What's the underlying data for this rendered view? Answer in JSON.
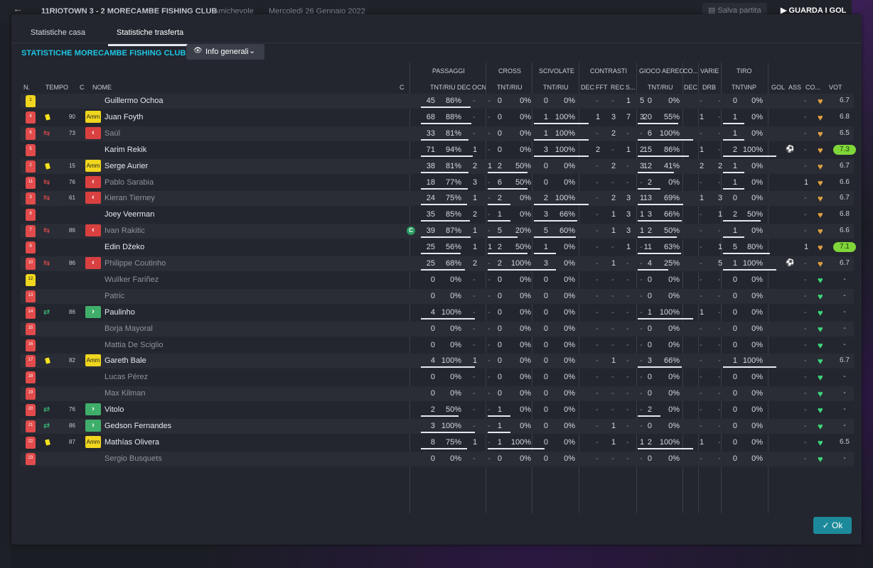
{
  "topbar": {
    "back_icon": "back-arrow-icon",
    "match": "11RIOTOWN   3 - 2   MORECAMBE FISHING CLUB",
    "type": "Amichevole",
    "date": "Mercoledì 26 Gennaio 2022",
    "save_label": "Salva partita",
    "goals_label": "GUARDA I GOL"
  },
  "tabs": [
    "Statistiche casa",
    "Statistiche trasferta"
  ],
  "active_tab": 1,
  "title": "STATISTICHE MORECAMBE FISHING CLUB",
  "dropdown": {
    "label": "Info generali",
    "icon": "eye-icon"
  },
  "groups": {
    "passaggi": "PASSAGGI",
    "cross": "CROSS",
    "scivolate": "SCIVOLATE",
    "contrasti": "CONTRASTI",
    "gioco_aereo": "GIOCO AEREO",
    "co": "CO...",
    "varie": "VARIE",
    "tiro": "TIRO"
  },
  "columns": {
    "n": "N.",
    "tempo": "TEMPO",
    "c": "C",
    "nome": "NOME",
    "c2": "C",
    "pass_tnt": "TNT/RIU",
    "pass_dec": "DEC",
    "pass_ocn": "OCN",
    "cross_tnt": "TNT/RIU",
    "sciv_tnt": "TNT/RIU",
    "con_dec": "DEC",
    "con_fft": "FFT",
    "con_rec": "REC",
    "con_s": "S...",
    "aereo_tnt": "TNT/RIU",
    "co_dec": "DEC",
    "drb": "DRB",
    "tiro": "TNT\\INP",
    "gol": "GOL",
    "ass": "ASS",
    "co2": "CO...",
    "vot": "VOT"
  },
  "players": [
    {
      "n": "1",
      "name": "Guillermo Ochoa",
      "gk": true,
      "dim": false,
      "card": false,
      "sub": "",
      "min": "",
      "pass": [
        "45",
        "86%"
      ],
      "pdec": "-",
      "pocn": "-",
      "cross": [
        "0",
        "0%"
      ],
      "sciv": [
        "0",
        "0%"
      ],
      "cdec": "-",
      "cfft": "-",
      "crec": "1",
      "cs": "5",
      "aereo": [
        "0",
        "0%"
      ],
      "codec": "-",
      "drb": "-",
      "tiro": [
        "0",
        "0%"
      ],
      "gol": "",
      "ass": "-",
      "vot": "6.7",
      "high": false,
      "c": false
    },
    {
      "n": "4",
      "name": "Juan Foyth",
      "gk": false,
      "dim": false,
      "card": true,
      "sub": "",
      "min": "90",
      "pass": [
        "68",
        "88%"
      ],
      "pdec": "-",
      "pocn": "-",
      "cross": [
        "0",
        "0%"
      ],
      "sciv": [
        "1",
        "100%"
      ],
      "cdec": "1",
      "cfft": "3",
      "crec": "7",
      "cs": "3",
      "aereo": [
        "20",
        "55%"
      ],
      "codec": "1",
      "drb": "-",
      "tiro": [
        "1",
        "0%"
      ],
      "gol": "",
      "ass": "-",
      "vot": "6.8",
      "high": false,
      "c": false
    },
    {
      "n": "6",
      "name": "Saúl",
      "gk": false,
      "dim": true,
      "card": false,
      "sub": "out",
      "min": "73",
      "pass": [
        "33",
        "81%"
      ],
      "pdec": "-",
      "pocn": "-",
      "cross": [
        "0",
        "0%"
      ],
      "sciv": [
        "1",
        "100%"
      ],
      "cdec": "-",
      "cfft": "2",
      "crec": "-",
      "cs": "-",
      "aereo": [
        "6",
        "100%"
      ],
      "codec": "-",
      "drb": "-",
      "tiro": [
        "1",
        "0%"
      ],
      "gol": "",
      "ass": "-",
      "vot": "6.5",
      "high": false,
      "c": false
    },
    {
      "n": "5",
      "name": "Karim Rekik",
      "gk": false,
      "dim": false,
      "card": false,
      "sub": "",
      "min": "",
      "pass": [
        "71",
        "94%"
      ],
      "pdec": "1",
      "pocn": "-",
      "cross": [
        "0",
        "0%"
      ],
      "sciv": [
        "3",
        "100%"
      ],
      "cdec": "2",
      "cfft": "-",
      "crec": "1",
      "cs": "2",
      "aereo": [
        "15",
        "86%"
      ],
      "codec": "1",
      "drb": "-",
      "tiro": [
        "2",
        "100%"
      ],
      "gol": "goal",
      "ass": "-",
      "vot": "7.3",
      "high": true,
      "c": false
    },
    {
      "n": "2",
      "name": "Serge Aurier",
      "gk": false,
      "dim": false,
      "card": true,
      "sub": "",
      "min": "15",
      "pass": [
        "38",
        "81%"
      ],
      "pdec": "2",
      "pocn": "1",
      "cross": [
        "2",
        "50%"
      ],
      "sciv": [
        "0",
        "0%"
      ],
      "cdec": "-",
      "cfft": "2",
      "crec": "-",
      "cs": "3",
      "aereo": [
        "12",
        "41%"
      ],
      "codec": "2",
      "drb": "2",
      "tiro": [
        "1",
        "0%"
      ],
      "gol": "",
      "ass": "-",
      "vot": "6.7",
      "high": false,
      "c": false
    },
    {
      "n": "11",
      "name": "Pablo Sarabia",
      "gk": false,
      "dim": true,
      "card": false,
      "sub": "out",
      "min": "76",
      "pass": [
        "18",
        "77%"
      ],
      "pdec": "3",
      "pocn": "-",
      "cross": [
        "6",
        "50%"
      ],
      "sciv": [
        "0",
        "0%"
      ],
      "cdec": "-",
      "cfft": "-",
      "crec": "-",
      "cs": "-",
      "aereo": [
        "2",
        "0%"
      ],
      "codec": "-",
      "drb": "-",
      "tiro": [
        "1",
        "0%"
      ],
      "gol": "",
      "ass": "1",
      "vot": "6.6",
      "high": false,
      "c": false
    },
    {
      "n": "3",
      "name": "Kieran Tierney",
      "gk": false,
      "dim": true,
      "card": false,
      "sub": "out",
      "min": "61",
      "pass": [
        "24",
        "75%"
      ],
      "pdec": "1",
      "pocn": "-",
      "cross": [
        "2",
        "0%"
      ],
      "sciv": [
        "2",
        "100%"
      ],
      "cdec": "-",
      "cfft": "2",
      "crec": "3",
      "cs": "1",
      "aereo": [
        "13",
        "69%"
      ],
      "codec": "1",
      "drb": "3",
      "tiro": [
        "0",
        "0%"
      ],
      "gol": "",
      "ass": "-",
      "vot": "6.7",
      "high": false,
      "c": false
    },
    {
      "n": "8",
      "name": "Joey Veerman",
      "gk": false,
      "dim": false,
      "card": false,
      "sub": "",
      "min": "",
      "pass": [
        "35",
        "85%"
      ],
      "pdec": "2",
      "pocn": "-",
      "cross": [
        "1",
        "0%"
      ],
      "sciv": [
        "3",
        "66%"
      ],
      "cdec": "-",
      "cfft": "1",
      "crec": "3",
      "cs": "1",
      "aereo": [
        "3",
        "66%"
      ],
      "codec": "-",
      "drb": "1",
      "tiro": [
        "2",
        "50%"
      ],
      "gol": "",
      "ass": "-",
      "vot": "6.8",
      "high": false,
      "c": false
    },
    {
      "n": "7",
      "name": "Ivan Rakitic",
      "gk": false,
      "dim": true,
      "card": false,
      "sub": "out",
      "min": "86",
      "pass": [
        "39",
        "87%"
      ],
      "pdec": "1",
      "pocn": "-",
      "cross": [
        "5",
        "20%"
      ],
      "sciv": [
        "5",
        "60%"
      ],
      "cdec": "-",
      "cfft": "1",
      "crec": "3",
      "cs": "1",
      "aereo": [
        "2",
        "50%"
      ],
      "codec": "-",
      "drb": "-",
      "tiro": [
        "1",
        "0%"
      ],
      "gol": "",
      "ass": "-",
      "vot": "6.6",
      "high": false,
      "c": true
    },
    {
      "n": "9",
      "name": "Edin Džeko",
      "gk": false,
      "dim": false,
      "card": false,
      "sub": "",
      "min": "",
      "pass": [
        "25",
        "56%"
      ],
      "pdec": "1",
      "pocn": "1",
      "cross": [
        "2",
        "50%"
      ],
      "sciv": [
        "1",
        "0%"
      ],
      "cdec": "-",
      "cfft": "-",
      "crec": "1",
      "cs": "-",
      "aereo": [
        "11",
        "63%"
      ],
      "codec": "-",
      "drb": "1",
      "tiro": [
        "5",
        "80%"
      ],
      "gol": "",
      "ass": "1",
      "vot": "7.1",
      "high": true,
      "c": false
    },
    {
      "n": "10",
      "name": "Philippe Coutinho",
      "gk": false,
      "dim": true,
      "card": false,
      "sub": "out",
      "min": "86",
      "pass": [
        "25",
        "68%"
      ],
      "pdec": "2",
      "pocn": "-",
      "cross": [
        "2",
        "100%"
      ],
      "sciv": [
        "3",
        "0%"
      ],
      "cdec": "-",
      "cfft": "1",
      "crec": "-",
      "cs": "-",
      "aereo": [
        "4",
        "25%"
      ],
      "codec": "-",
      "drb": "5",
      "tiro": [
        "1",
        "100%"
      ],
      "gol": "goal",
      "ass": "-",
      "vot": "6.7",
      "high": false,
      "c": false
    },
    {
      "n": "12",
      "name": "Wuilker Fariñez",
      "gk": true,
      "dim": true,
      "card": false,
      "sub": "",
      "min": "",
      "pass": [
        "0",
        "0%"
      ],
      "pdec": "-",
      "pocn": "-",
      "cross": [
        "0",
        "0%"
      ],
      "sciv": [
        "0",
        "0%"
      ],
      "cdec": "-",
      "cfft": "-",
      "crec": "-",
      "cs": "-",
      "aereo": [
        "0",
        "0%"
      ],
      "codec": "-",
      "drb": "-",
      "tiro": [
        "0",
        "0%"
      ],
      "gol": "",
      "ass": "-",
      "vot": "-",
      "high": false,
      "c": false
    },
    {
      "n": "13",
      "name": "Patric",
      "gk": false,
      "dim": true,
      "card": false,
      "sub": "",
      "min": "",
      "pass": [
        "0",
        "0%"
      ],
      "pdec": "-",
      "pocn": "-",
      "cross": [
        "0",
        "0%"
      ],
      "sciv": [
        "0",
        "0%"
      ],
      "cdec": "-",
      "cfft": "-",
      "crec": "-",
      "cs": "-",
      "aereo": [
        "0",
        "0%"
      ],
      "codec": "-",
      "drb": "-",
      "tiro": [
        "0",
        "0%"
      ],
      "gol": "",
      "ass": "-",
      "vot": "-",
      "high": false,
      "c": false
    },
    {
      "n": "14",
      "name": "Paulinho",
      "gk": false,
      "dim": false,
      "card": false,
      "sub": "in",
      "min": "86",
      "pass": [
        "4",
        "100%"
      ],
      "pdec": "-",
      "pocn": "-",
      "cross": [
        "0",
        "0%"
      ],
      "sciv": [
        "0",
        "0%"
      ],
      "cdec": "-",
      "cfft": "-",
      "crec": "-",
      "cs": "-",
      "aereo": [
        "1",
        "100%"
      ],
      "codec": "1",
      "drb": "-",
      "tiro": [
        "0",
        "0%"
      ],
      "gol": "",
      "ass": "-",
      "vot": "-",
      "high": false,
      "c": false
    },
    {
      "n": "15",
      "name": "Borja Mayoral",
      "gk": false,
      "dim": true,
      "card": false,
      "sub": "",
      "min": "",
      "pass": [
        "0",
        "0%"
      ],
      "pdec": "-",
      "pocn": "-",
      "cross": [
        "0",
        "0%"
      ],
      "sciv": [
        "0",
        "0%"
      ],
      "cdec": "-",
      "cfft": "-",
      "crec": "-",
      "cs": "-",
      "aereo": [
        "0",
        "0%"
      ],
      "codec": "-",
      "drb": "-",
      "tiro": [
        "0",
        "0%"
      ],
      "gol": "",
      "ass": "-",
      "vot": "-",
      "high": false,
      "c": false
    },
    {
      "n": "16",
      "name": "Mattia De Sciglio",
      "gk": false,
      "dim": true,
      "card": false,
      "sub": "",
      "min": "",
      "pass": [
        "0",
        "0%"
      ],
      "pdec": "-",
      "pocn": "-",
      "cross": [
        "0",
        "0%"
      ],
      "sciv": [
        "0",
        "0%"
      ],
      "cdec": "-",
      "cfft": "-",
      "crec": "-",
      "cs": "-",
      "aereo": [
        "0",
        "0%"
      ],
      "codec": "-",
      "drb": "-",
      "tiro": [
        "0",
        "0%"
      ],
      "gol": "",
      "ass": "-",
      "vot": "-",
      "high": false,
      "c": false
    },
    {
      "n": "17",
      "name": "Gareth Bale",
      "gk": false,
      "dim": false,
      "card": true,
      "sub": "",
      "min": "82",
      "pass": [
        "4",
        "100%"
      ],
      "pdec": "1",
      "pocn": "-",
      "cross": [
        "0",
        "0%"
      ],
      "sciv": [
        "0",
        "0%"
      ],
      "cdec": "-",
      "cfft": "1",
      "crec": "-",
      "cs": "-",
      "aereo": [
        "3",
        "66%"
      ],
      "codec": "-",
      "drb": "-",
      "tiro": [
        "1",
        "100%"
      ],
      "gol": "",
      "ass": "-",
      "vot": "6.7",
      "high": false,
      "c": false
    },
    {
      "n": "18",
      "name": "Lucas Pérez",
      "gk": false,
      "dim": true,
      "card": false,
      "sub": "",
      "min": "",
      "pass": [
        "0",
        "0%"
      ],
      "pdec": "-",
      "pocn": "-",
      "cross": [
        "0",
        "0%"
      ],
      "sciv": [
        "0",
        "0%"
      ],
      "cdec": "-",
      "cfft": "-",
      "crec": "-",
      "cs": "-",
      "aereo": [
        "0",
        "0%"
      ],
      "codec": "-",
      "drb": "-",
      "tiro": [
        "0",
        "0%"
      ],
      "gol": "",
      "ass": "-",
      "vot": "-",
      "high": false,
      "c": false
    },
    {
      "n": "19",
      "name": "Max Kilman",
      "gk": false,
      "dim": true,
      "card": false,
      "sub": "",
      "min": "",
      "pass": [
        "0",
        "0%"
      ],
      "pdec": "-",
      "pocn": "-",
      "cross": [
        "0",
        "0%"
      ],
      "sciv": [
        "0",
        "0%"
      ],
      "cdec": "-",
      "cfft": "-",
      "crec": "-",
      "cs": "-",
      "aereo": [
        "0",
        "0%"
      ],
      "codec": "-",
      "drb": "-",
      "tiro": [
        "0",
        "0%"
      ],
      "gol": "",
      "ass": "-",
      "vot": "-",
      "high": false,
      "c": false
    },
    {
      "n": "20",
      "name": "Vitolo",
      "gk": false,
      "dim": false,
      "card": false,
      "sub": "in",
      "min": "76",
      "pass": [
        "2",
        "50%"
      ],
      "pdec": "-",
      "pocn": "-",
      "cross": [
        "1",
        "0%"
      ],
      "sciv": [
        "0",
        "0%"
      ],
      "cdec": "-",
      "cfft": "-",
      "crec": "-",
      "cs": "-",
      "aereo": [
        "2",
        "0%"
      ],
      "codec": "-",
      "drb": "-",
      "tiro": [
        "0",
        "0%"
      ],
      "gol": "",
      "ass": "-",
      "vot": "-",
      "high": false,
      "c": false
    },
    {
      "n": "21",
      "name": "Gedson Fernandes",
      "gk": false,
      "dim": false,
      "card": false,
      "sub": "in",
      "min": "86",
      "pass": [
        "3",
        "100%"
      ],
      "pdec": "-",
      "pocn": "-",
      "cross": [
        "1",
        "0%"
      ],
      "sciv": [
        "0",
        "0%"
      ],
      "cdec": "-",
      "cfft": "1",
      "crec": "-",
      "cs": "-",
      "aereo": [
        "0",
        "0%"
      ],
      "codec": "-",
      "drb": "-",
      "tiro": [
        "0",
        "0%"
      ],
      "gol": "",
      "ass": "-",
      "vot": "-",
      "high": false,
      "c": false
    },
    {
      "n": "22",
      "name": "Mathías Olivera",
      "gk": false,
      "dim": false,
      "card": true,
      "sub": "",
      "min": "87",
      "pass": [
        "8",
        "75%"
      ],
      "pdec": "1",
      "pocn": "-",
      "cross": [
        "1",
        "100%"
      ],
      "sciv": [
        "0",
        "0%"
      ],
      "cdec": "-",
      "cfft": "1",
      "crec": "-",
      "cs": "1",
      "aereo": [
        "2",
        "100%"
      ],
      "codec": "1",
      "drb": "-",
      "tiro": [
        "0",
        "0%"
      ],
      "gol": "",
      "ass": "-",
      "vot": "6.5",
      "high": false,
      "c": false
    },
    {
      "n": "23",
      "name": "Sergio Busquets",
      "gk": false,
      "dim": true,
      "card": false,
      "sub": "",
      "min": "",
      "pass": [
        "0",
        "0%"
      ],
      "pdec": "-",
      "pocn": "-",
      "cross": [
        "0",
        "0%"
      ],
      "sciv": [
        "0",
        "0%"
      ],
      "cdec": "-",
      "cfft": "-",
      "crec": "-",
      "cs": "-",
      "aereo": [
        "0",
        "0%"
      ],
      "codec": "-",
      "drb": "-",
      "tiro": [
        "0",
        "0%"
      ],
      "gol": "",
      "ass": "-",
      "vot": "-",
      "high": false,
      "c": false
    }
  ],
  "labels": {
    "amm": "Amm",
    "c_badge": "C"
  },
  "ok_label": "Ok",
  "colors": {
    "title": "#1ec7e6",
    "rating_high": "#7fd639",
    "ok_button": "#1c8a9a"
  }
}
